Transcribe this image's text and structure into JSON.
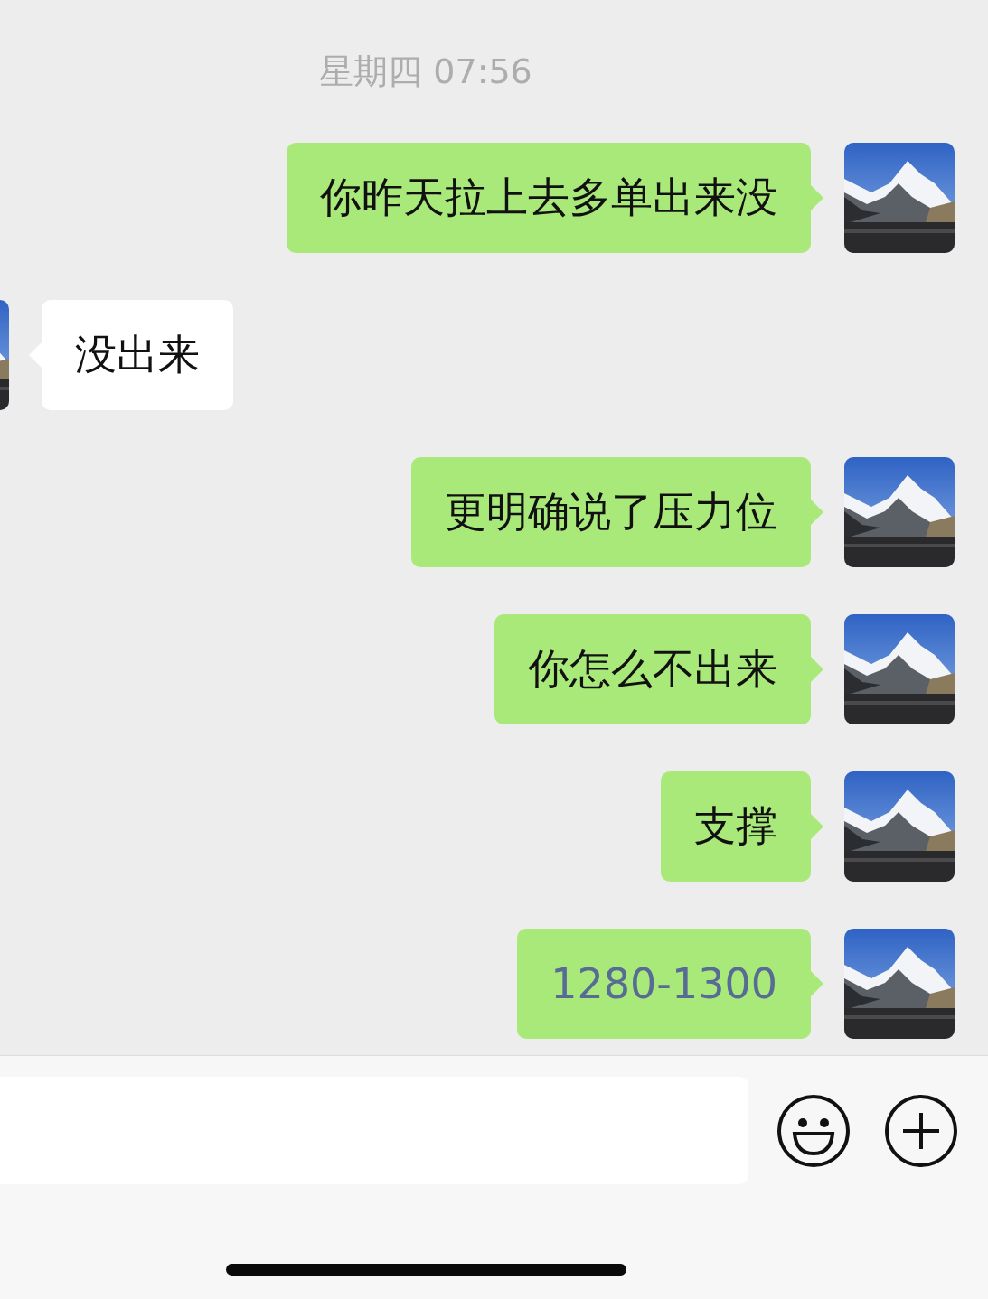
{
  "timestamp": "星期四 07:56",
  "messages": [
    {
      "kind": "sent",
      "text": "你昨天拉上去多单出来没",
      "link": false
    },
    {
      "kind": "received",
      "text": "没出来",
      "link": false
    },
    {
      "kind": "sent",
      "text": "更明确说了压力位",
      "link": false
    },
    {
      "kind": "sent",
      "text": "你怎么不出来",
      "link": false
    },
    {
      "kind": "sent",
      "text": "支撑",
      "link": false
    },
    {
      "kind": "sent",
      "text": "1280-1300",
      "link": true
    }
  ]
}
